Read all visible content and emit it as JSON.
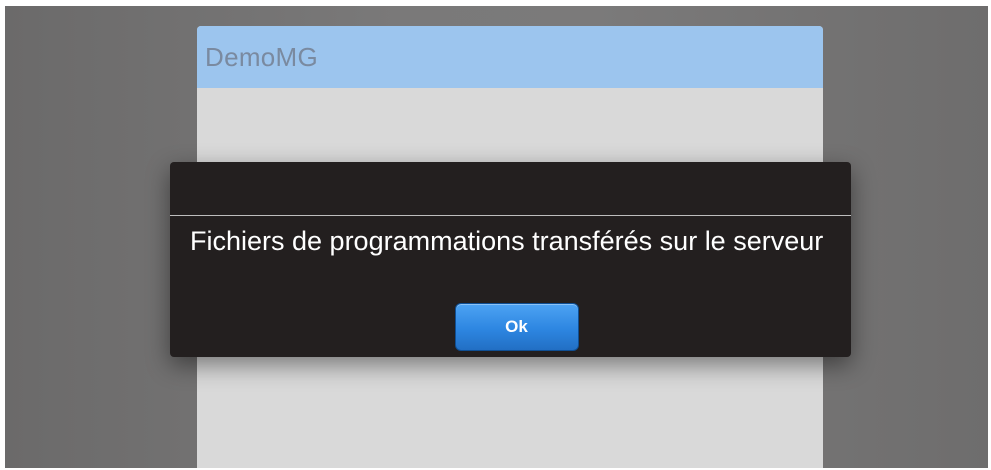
{
  "app": {
    "title": "DemoMG"
  },
  "dialog": {
    "message": "Fichiers de programmations transférés sur le serveur",
    "ok_label": "Ok"
  },
  "colors": {
    "backdrop": "#7a7979",
    "header": "#9cc5ee",
    "panel": "#d9d9d9",
    "dialog": "#231f1f",
    "button": "#2d86e1"
  }
}
